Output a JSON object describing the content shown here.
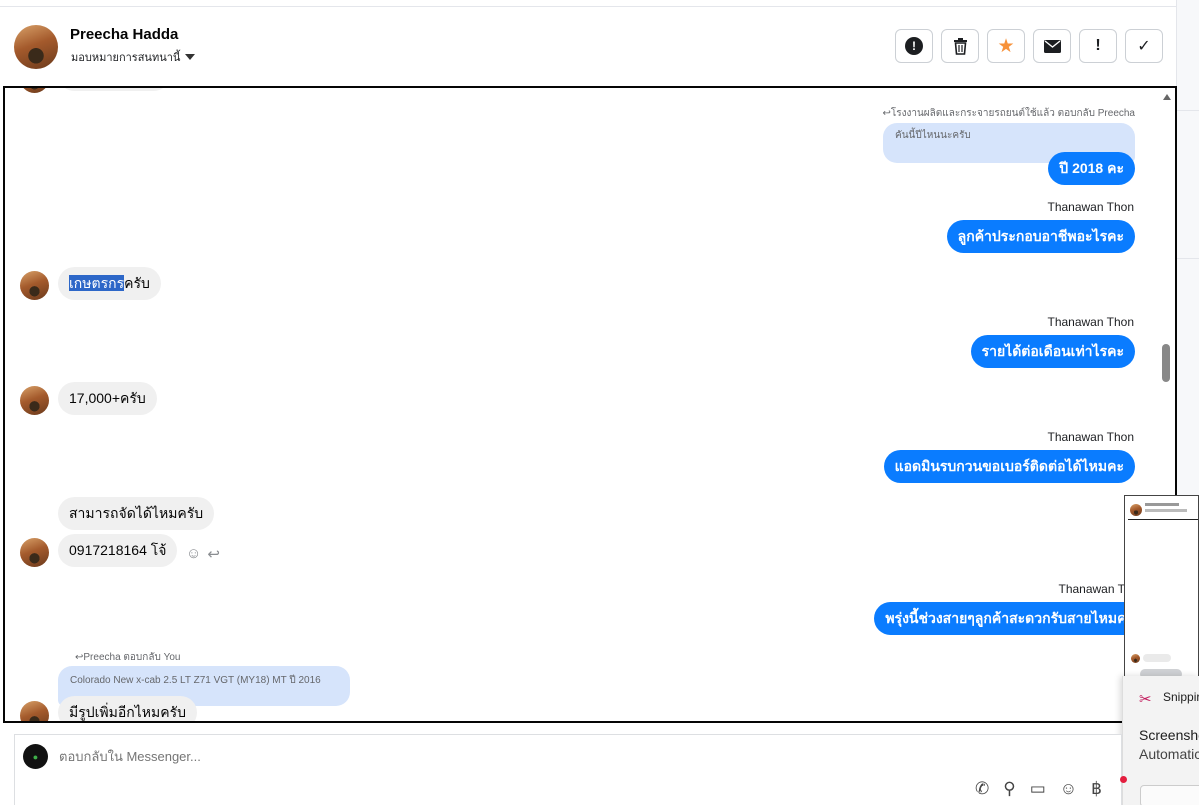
{
  "header": {
    "name": "Preecha Hadda",
    "assign_label": "มอบหมายการสนทนานี้",
    "actions": [
      {
        "icon": "alert-circle-icon",
        "glyph": "!"
      },
      {
        "icon": "trash-icon",
        "glyph": "🗑"
      },
      {
        "icon": "star-icon",
        "glyph": "★",
        "color": "#f7923b"
      },
      {
        "icon": "envelope-icon",
        "glyph": "✉"
      },
      {
        "icon": "exclamation-icon",
        "glyph": "!"
      },
      {
        "icon": "check-icon",
        "glyph": "✓"
      }
    ]
  },
  "messages": {
    "reply_meta_1": "โรงงานผลิตและกระจายรถยนต์ใช้แล้ว ตอบกลับ Preecha",
    "quote_1": "คันนี้ปีไหนนะครับ",
    "out_1": "ปี 2018 คะ",
    "sender_1": "Thanawan Thon",
    "out_2": "ลูกค้าประกอบอาชีพอะไรคะ",
    "in_1_highlight": "เกษตรกร",
    "in_1_rest": "ครับ",
    "sender_2": "Thanawan Thon",
    "out_3": "รายได้ต่อเดือนเท่าไรคะ",
    "in_2": "17,000+ครับ",
    "sender_3": "Thanawan Thon",
    "out_4": "แอดมินรบกวนขอเบอร์ติดต่อได้ไหมคะ",
    "in_3": "สามารถจัดได้ไหมครับ",
    "in_4": "0917218164 โจ้",
    "sender_4": "Thanawan Thon",
    "out_5": "พรุ่งนี้ช่วงสายๆลูกค้าสะดวกรับสายไหมคะ",
    "reply_meta_2": "Preecha ตอบกลับ You",
    "quote_2": "Colorado New x-cab 2.5 LT Z71 VGT (MY18) MT ปี 2016",
    "in_5": "มีรูปเพิ่มอีกไหมครับ"
  },
  "composer": {
    "placeholder": "ตอบกลับใน Messenger...",
    "logo_text": "●"
  },
  "snipping": {
    "title": "Snippir",
    "heading": "Screensho",
    "subtext": "Automatic"
  },
  "colors": {
    "outgoing": "#0a7cff",
    "incoming": "#f0f0f0",
    "quote": "#d6e4fb",
    "highlight": "#2d67c8"
  }
}
